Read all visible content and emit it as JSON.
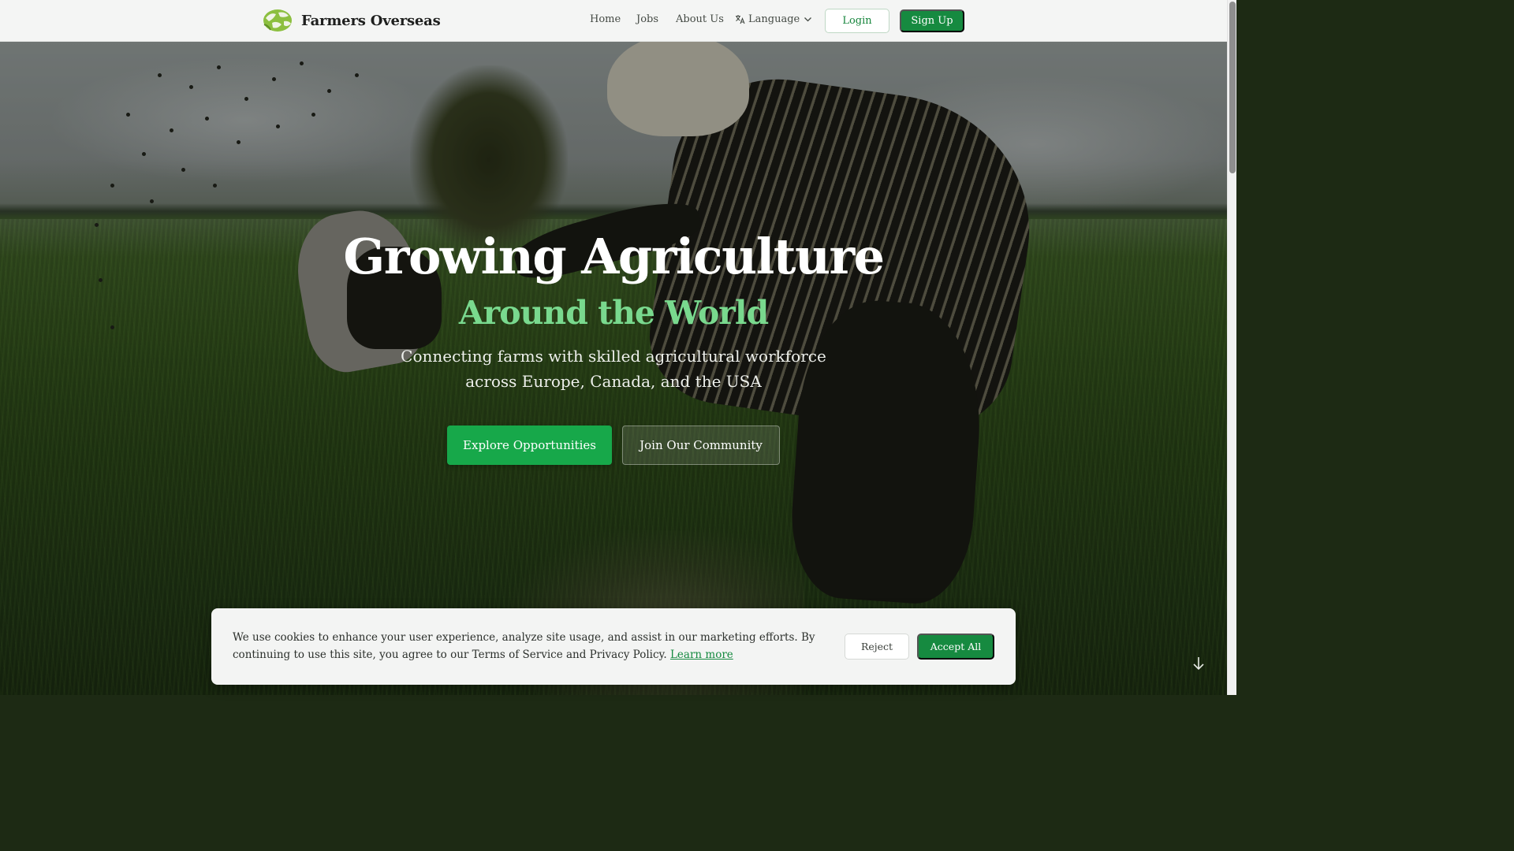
{
  "navbar": {
    "brand_name": "Farmers Overseas",
    "logo_icon": "globe-leaf-logo",
    "links": {
      "home": "Home",
      "jobs": "Jobs",
      "about": "About Us",
      "language": "Language"
    },
    "login_label": "Login",
    "signup_label": "Sign Up"
  },
  "hero": {
    "title": "Growing Agriculture",
    "subtitle": "Around the World",
    "description": "Connecting farms with skilled agricultural workforce across Europe, Canada, and the USA",
    "primary_cta": "Explore Opportunities",
    "secondary_cta": "Join Our Community"
  },
  "cookie_banner": {
    "text": "We use cookies to enhance your user experience, analyze site usage, and assist in our marketing efforts. By continuing to use this site, you agree to our Terms of Service and Privacy Policy.",
    "learn_more": "Learn more",
    "reject_label": "Reject",
    "accept_label": "Accept All"
  },
  "colors": {
    "brand_green": "#168a40",
    "cta_green": "#17a84a",
    "accent_light_green": "#79d98e"
  },
  "icons": {
    "language": "translate-icon",
    "dropdown": "chevron-down-icon",
    "scroll": "arrow-down-icon"
  }
}
